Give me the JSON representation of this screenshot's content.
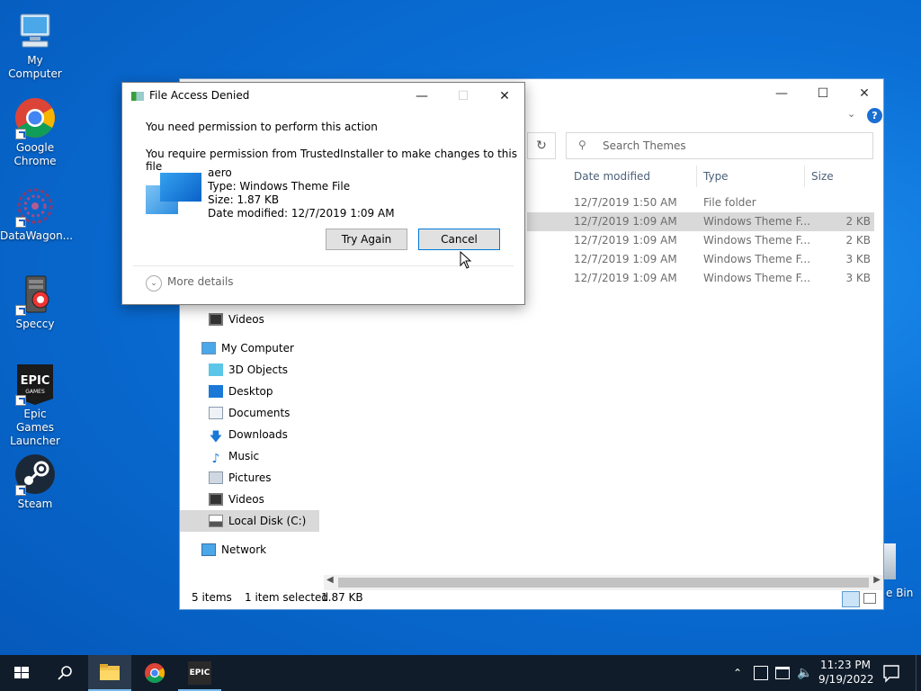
{
  "desktop": {
    "icons": [
      {
        "label": "My Computer",
        "icon": "computer-icon"
      },
      {
        "label": "Google Chrome",
        "icon": "chrome-icon"
      },
      {
        "label": "DataWagon...",
        "icon": "datawagon-icon"
      },
      {
        "label": "Speccy",
        "icon": "speccy-icon"
      },
      {
        "label": "Epic Games Launcher",
        "icon": "epic-games-icon"
      },
      {
        "label": "Steam",
        "icon": "steam-icon"
      },
      {
        "label": "e Bin",
        "icon": "recycle-bin-icon"
      }
    ]
  },
  "explorer": {
    "search_placeholder": "Search Themes",
    "columns": {
      "date": "Date modified",
      "type": "Type",
      "size": "Size"
    },
    "rows": [
      {
        "date": "12/7/2019 1:50 AM",
        "type": "File folder",
        "size": ""
      },
      {
        "date": "12/7/2019 1:09 AM",
        "type": "Windows Theme F...",
        "size": "2 KB"
      },
      {
        "date": "12/7/2019 1:09 AM",
        "type": "Windows Theme F...",
        "size": "2 KB"
      },
      {
        "date": "12/7/2019 1:09 AM",
        "type": "Windows Theme F...",
        "size": "3 KB"
      },
      {
        "date": "12/7/2019 1:09 AM",
        "type": "Windows Theme F...",
        "size": "3 KB"
      }
    ],
    "nav": {
      "videos_top": "Videos",
      "my_computer": "My Computer",
      "objects3d": "3D Objects",
      "desktop": "Desktop",
      "documents": "Documents",
      "downloads": "Downloads",
      "music": "Music",
      "pictures": "Pictures",
      "videos": "Videos",
      "local_disk": "Local Disk (C:)",
      "network": "Network"
    },
    "status": {
      "items": "5 items",
      "selected": "1 item selected",
      "size": "1.87 KB"
    }
  },
  "dialog": {
    "title": "File Access Denied",
    "heading": "You need permission to perform this action",
    "message": "You require permission from TrustedInstaller to make changes to this file",
    "file": {
      "name": "aero",
      "type": "Type: Windows Theme File",
      "size": "Size: 1.87 KB",
      "modified": "Date modified: 12/7/2019 1:09 AM"
    },
    "try_again": "Try Again",
    "cancel": "Cancel",
    "more_details": "More details"
  },
  "taskbar": {
    "time": "11:23 PM",
    "date": "9/19/2022",
    "epic_label": "EPIC"
  },
  "colors": {
    "desktop": "#0a6fd6",
    "taskbar": "#101c2a",
    "selection": "#d9d9d9",
    "link": "#0078d7"
  }
}
